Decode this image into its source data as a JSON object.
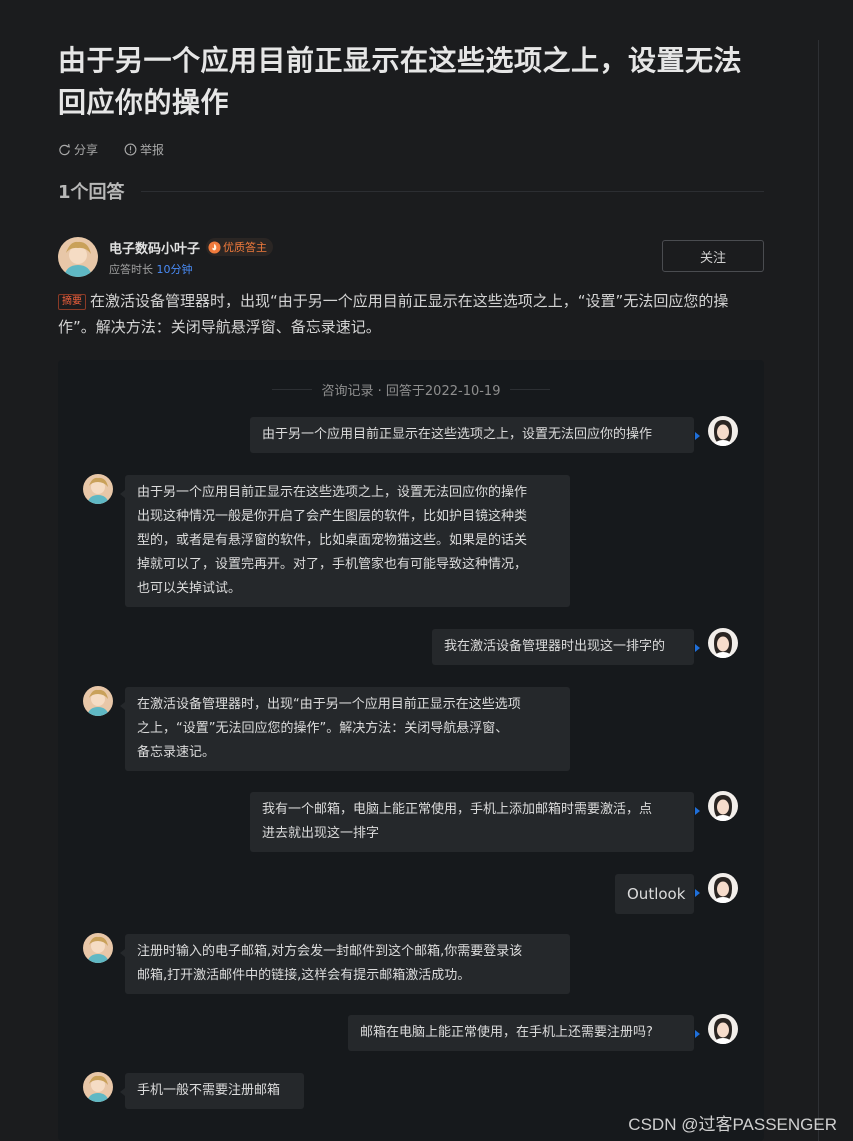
{
  "question": {
    "title": "由于另一个应用目前正显示在这些选项之上，设置无法回应你的操作",
    "share_label": "分享",
    "report_label": "举报"
  },
  "answers": {
    "count_label": "1个回答"
  },
  "author": {
    "name": "电子数码小叶子",
    "badge": "优质答主",
    "response_prefix": "应答时长",
    "response_time": "10分钟",
    "follow_label": "关注"
  },
  "summary": {
    "tag": "摘要",
    "text": "在激活设备管理器时，出现“由于另一个应用目前正显示在这些选项之上，“设置”无法回应您的操作”。解决方法：关闭导航悬浮窗、备忘录速记。"
  },
  "consult": {
    "header": "咨询记录 · 回答于2022-10-19",
    "messages": [
      {
        "from": "user",
        "lines": [
          "由于另一个应用目前正显示在这些选项之上，设置无法回应你的操作"
        ]
      },
      {
        "from": "expert",
        "lines": [
          "由于另一个应用目前正显示在这些选项之上，设置无法回应你的操作",
          "出现这种情况一般是你开启了会产生图层的软件，比如护目镜这种类",
          "型的，或者是有悬浮窗的软件，比如桌面宠物猫这些。如果是的话关",
          "掉就可以了，设置完再开。对了，手机管家也有可能导致这种情况，",
          "也可以关掉试试。"
        ]
      },
      {
        "from": "user",
        "lines": [
          "我在激活设备管理器时出现这一排字的"
        ]
      },
      {
        "from": "expert",
        "lines": [
          "在激活设备管理器时，出现“由于另一个应用目前正显示在这些选项",
          "之上，“设置”无法回应您的操作”。解决方法：关闭导航悬浮窗、",
          "备忘录速记。"
        ]
      },
      {
        "from": "user",
        "lines": [
          "我有一个邮箱，电脑上能正常使用，手机上添加邮箱时需要激活，点",
          "进去就出现这一排字"
        ]
      },
      {
        "from": "user",
        "lines": [
          "Outlook"
        ]
      },
      {
        "from": "expert",
        "lines": [
          "注册时输入的电子邮箱,对方会发一封邮件到这个邮箱,你需要登录该",
          "邮箱,打开激活邮件中的链接,这样会有提示邮箱激活成功。"
        ]
      },
      {
        "from": "user",
        "lines": [
          "邮箱在电脑上能正常使用，在手机上还需要注册吗?"
        ]
      },
      {
        "from": "expert",
        "lines": [
          "手机一般不需要注册邮箱"
        ]
      }
    ]
  },
  "watermark": "CSDN @过客PASSENGER",
  "colors": {
    "background": "#1b1c1e",
    "bubble": "#25282b",
    "accent_blue": "#4a8cf7",
    "badge_orange": "#f07a3c"
  }
}
